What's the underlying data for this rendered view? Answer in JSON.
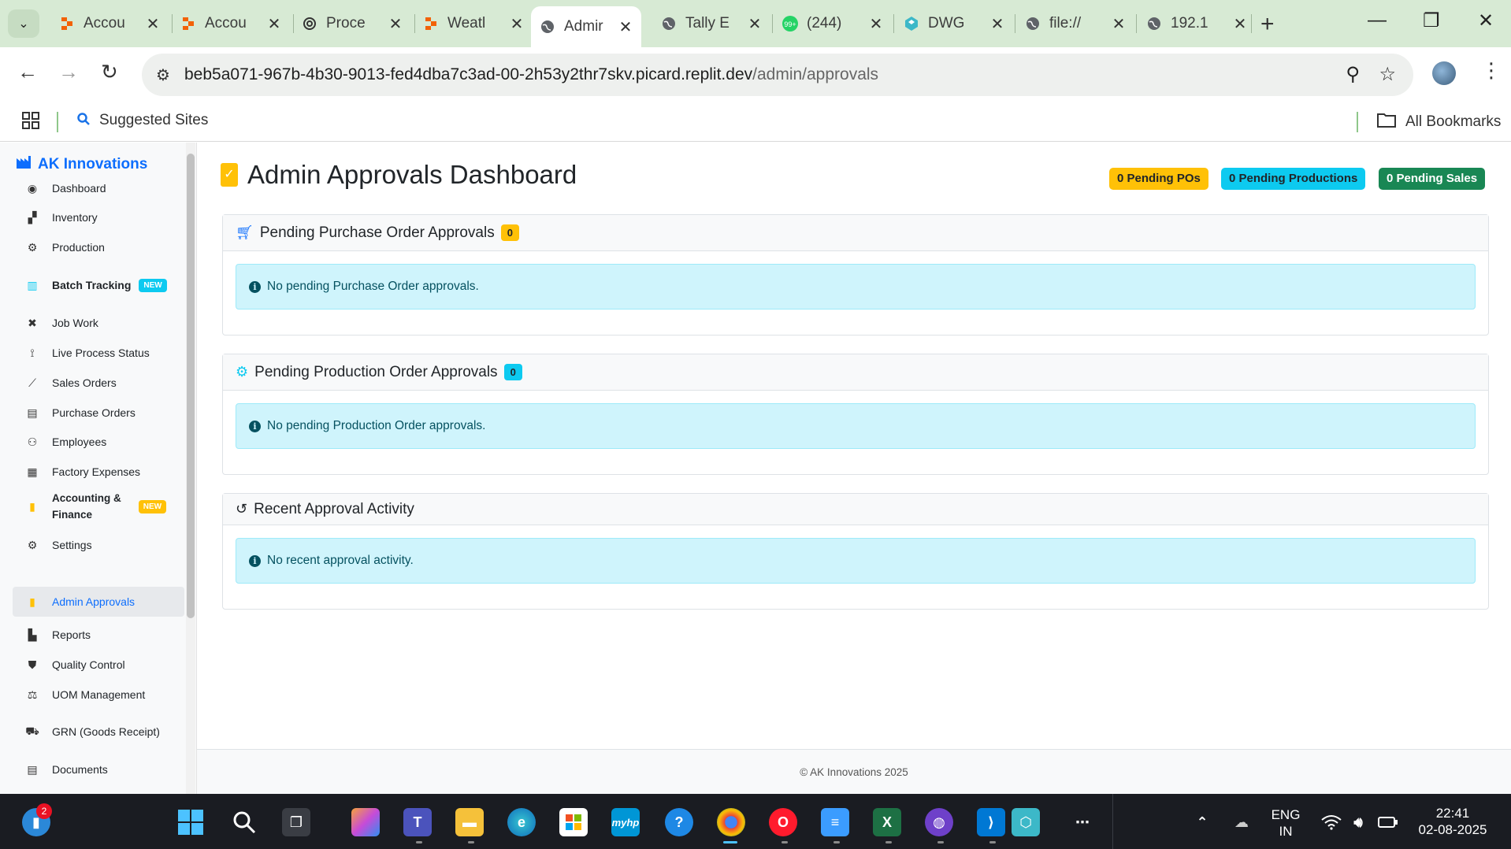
{
  "browser": {
    "tabs": [
      {
        "title": "Accou",
        "icon": "replit-icon"
      },
      {
        "title": "Accou",
        "icon": "replit-icon"
      },
      {
        "title": "Proce",
        "icon": "openai-icon"
      },
      {
        "title": "Weatl",
        "icon": "replit-icon"
      },
      {
        "title": "Admir",
        "icon": "globe-icon"
      },
      {
        "title": "Tally E",
        "icon": "globe-icon"
      },
      {
        "title": "(244)",
        "icon": "whatsapp-icon"
      },
      {
        "title": "DWG",
        "icon": "dwg-icon"
      },
      {
        "title": "file://",
        "icon": "globe-icon"
      },
      {
        "title": "192.1",
        "icon": "globe-icon"
      }
    ],
    "url_host": "beb5a071-967b-4b30-9013-fed4dba7c3ad-00-2h53y2thr7skv.picard.replit.dev",
    "url_path": "/admin/approvals",
    "bookmarks": {
      "suggested": "Suggested Sites",
      "all": "All Bookmarks"
    }
  },
  "sidebar": {
    "brand": "AK Innovations",
    "new_badge": "NEW",
    "items": [
      {
        "label": "Dashboard",
        "icon": "palette-icon"
      },
      {
        "label": "Inventory",
        "icon": "boxes-icon"
      },
      {
        "label": "Production",
        "icon": "cogs-icon"
      },
      {
        "label": "Batch Tracking",
        "icon": "barcode-icon"
      },
      {
        "label": "Job Work",
        "icon": "tools-icon"
      },
      {
        "label": "Live Process Status",
        "icon": "broadcast-icon"
      },
      {
        "label": "Sales Orders",
        "icon": "chart-line-icon"
      },
      {
        "label": "Purchase Orders",
        "icon": "file-invoice-icon"
      },
      {
        "label": "Employees",
        "icon": "users-icon"
      },
      {
        "label": "Factory Expenses",
        "icon": "receipt-icon"
      },
      {
        "label": "Accounting &",
        "label2": "Finance",
        "icon": "calculator-icon"
      },
      {
        "label": "Settings",
        "icon": "gear-icon"
      },
      {
        "label": "Admin Approvals",
        "icon": "clipboard-check-icon"
      },
      {
        "label": "Reports",
        "icon": "chart-bar-icon"
      },
      {
        "label": "Quality Control",
        "icon": "shield-icon"
      },
      {
        "label": "UOM Management",
        "icon": "balance-scale-icon"
      },
      {
        "label": "GRN (Goods Receipt)",
        "icon": "truck-icon"
      },
      {
        "label": "Documents",
        "icon": "file-icon"
      }
    ]
  },
  "main": {
    "title": "Admin Approvals Dashboard",
    "stats": {
      "po": "0 Pending POs",
      "production": "0 Pending Productions",
      "sales": "0 Pending Sales"
    },
    "cards": [
      {
        "title": "Pending Purchase Order Approvals",
        "count": "0",
        "message": "No pending Purchase Order approvals."
      },
      {
        "title": "Pending Production Order Approvals",
        "count": "0",
        "message": "No pending Production Order approvals."
      },
      {
        "title": "Recent Approval Activity",
        "message": "No recent approval activity."
      }
    ],
    "footer": "© AK Innovations 2025"
  },
  "taskbar": {
    "notification_count": "2",
    "lang": "ENG",
    "region": "IN",
    "time": "22:41",
    "date": "02-08-2025"
  },
  "colors": {
    "primary": "#0d6efd",
    "warning": "#ffc107",
    "info": "#0dcaf0",
    "success": "#198754",
    "alert_bg": "#cff4fc"
  }
}
